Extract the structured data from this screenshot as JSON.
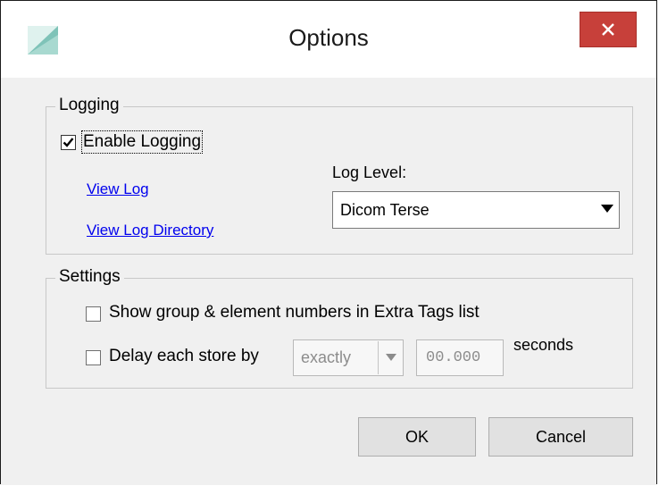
{
  "window": {
    "title": "Options",
    "icons": {
      "app": "app-logo-icon",
      "close": "close-icon"
    },
    "colors": {
      "close_button": "#c7403a",
      "link": "#0000ee"
    }
  },
  "logging": {
    "group_label": "Logging",
    "enable_logging": {
      "label": "Enable Logging",
      "checked": true
    },
    "view_log_link": "View Log",
    "view_log_directory_link": "View Log Directory",
    "log_level_label": "Log Level:",
    "log_level_value": "Dicom Terse"
  },
  "settings": {
    "group_label": "Settings",
    "show_numbers": {
      "label": "Show group & element numbers in Extra Tags list",
      "checked": false
    },
    "delay_store": {
      "label": "Delay each store by",
      "checked": false
    },
    "delay_mode_value": "exactly",
    "delay_seconds_value": "00.000",
    "seconds_label": "seconds"
  },
  "buttons": {
    "ok": "OK",
    "cancel": "Cancel"
  }
}
